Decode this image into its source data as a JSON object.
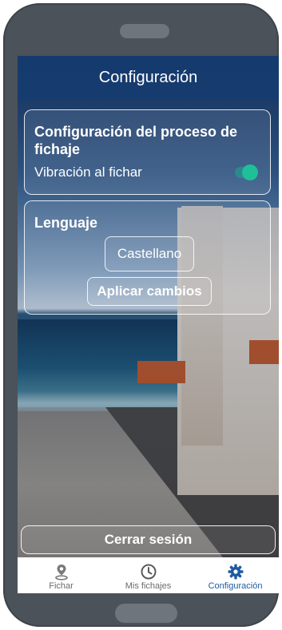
{
  "header": {
    "title": "Configuración"
  },
  "process_card": {
    "title": "Configuración del proceso de fichaje",
    "vibration_label": "Vibración al fichar",
    "vibration_enabled": true
  },
  "language_card": {
    "title": "Lenguaje",
    "selected_language": "Castellano",
    "apply_label": "Aplicar cambios"
  },
  "logout": {
    "label": "Cerrar sesión"
  },
  "tabs": [
    {
      "label": "Fichar",
      "icon": "location-pin-icon",
      "active": false
    },
    {
      "label": "Mis fichajes",
      "icon": "clock-icon",
      "active": false
    },
    {
      "label": "Configuración",
      "icon": "gear-icon",
      "active": true
    }
  ],
  "colors": {
    "accent": "#1f5aa3",
    "toggle_on": "#1fbf98",
    "header_bg": "#163c70"
  }
}
